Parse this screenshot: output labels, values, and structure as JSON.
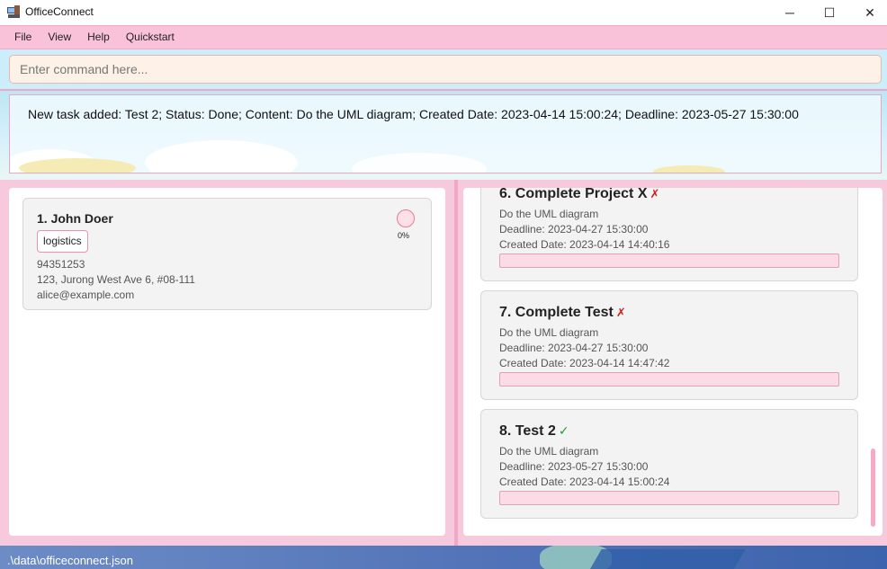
{
  "window": {
    "title": "OfficeConnect",
    "controls": {
      "minimize": "─",
      "maximize": "☐",
      "close": "✕"
    }
  },
  "menu": [
    "File",
    "View",
    "Help",
    "Quickstart"
  ],
  "command": {
    "placeholder": "Enter command here..."
  },
  "result": {
    "message": "New task added: Test 2; Status: Done; Content: Do the UML diagram; Created Date: 2023-04-14 15:00:24; Deadline: 2023-05-27 15:30:00"
  },
  "persons": [
    {
      "name": "1.  John Doer",
      "tag": "logistics",
      "progress": "0%",
      "phone": "94351253",
      "address": "123, Jurong West Ave 6, #08-111",
      "email": "alice@example.com"
    }
  ],
  "tasks": [
    {
      "title": "6.  Complete Project X",
      "status": "✗",
      "content": "Do the UML diagram",
      "deadline": "Deadline: 2023-04-27 15:30:00",
      "created": "Created Date: 2023-04-14 14:40:16"
    },
    {
      "title": "7.  Complete Test",
      "status": "✗",
      "content": "Do the UML diagram",
      "deadline": "Deadline: 2023-04-27 15:30:00",
      "created": "Created Date: 2023-04-14 14:47:42"
    },
    {
      "title": "8.  Test 2",
      "status": "✓",
      "content": "Do the UML diagram",
      "deadline": "Deadline: 2023-05-27 15:30:00",
      "created": "Created Date: 2023-04-14 15:00:24"
    }
  ],
  "statusbar": {
    "path": ".\\data\\officeconnect.json"
  },
  "colors": {
    "accent_pink": "#f9c2d9",
    "command_bg": "#cbeefa",
    "done": "#1f9e2c",
    "not_done": "#d01c1c"
  }
}
